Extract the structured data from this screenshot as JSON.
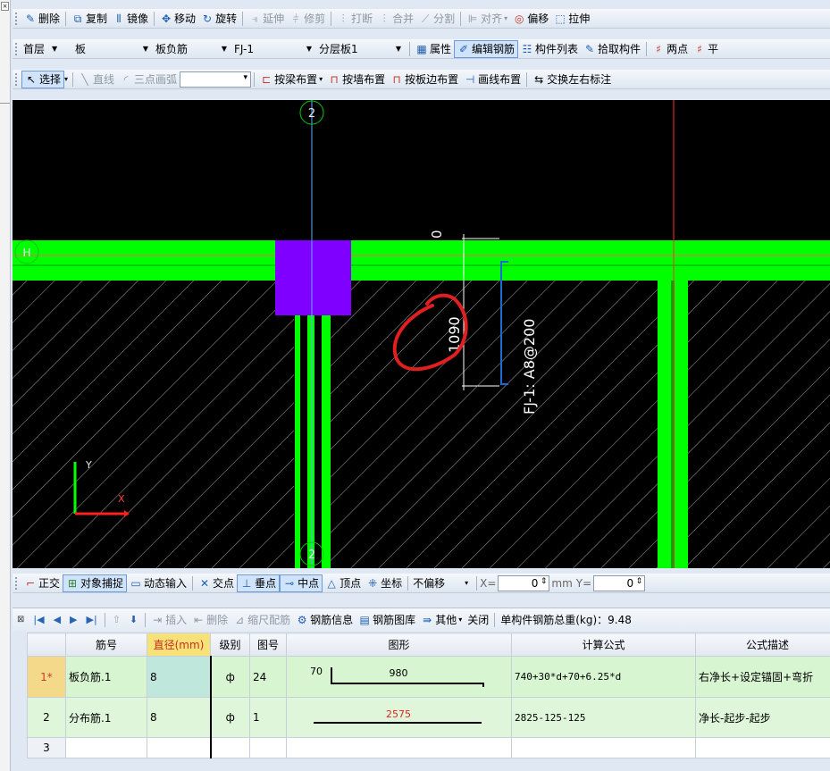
{
  "toolbar1": {
    "delete": "删除",
    "copy": "复制",
    "mirror": "镜像",
    "move": "移动",
    "rotate": "旋转",
    "extend": "延伸",
    "trim": "修剪",
    "break": "打断",
    "merge": "合并",
    "split": "分割",
    "align": "对齐",
    "offset": "偏移",
    "stretch": "拉伸"
  },
  "toolbar2": {
    "floor": "首层",
    "category": "板",
    "type": "板负筋",
    "name": "FJ-1",
    "layer": "分层板1",
    "properties": "属性",
    "edit_rebar": "编辑钢筋",
    "component_list": "构件列表",
    "pick_component": "拾取构件",
    "two_points": "两点",
    "parallel": "平"
  },
  "toolbar3": {
    "select": "选择",
    "line": "直线",
    "arc3": "三点画弧",
    "by_beam": "按梁布置",
    "by_wall": "按墙布置",
    "by_slab_edge": "按板边布置",
    "by_line": "画线布置",
    "swap_labels": "交换左右标注"
  },
  "canvas": {
    "axis_top": "2",
    "axis_bottom": "2",
    "axis_left": "H",
    "dim_zero": "0",
    "dim_length": "1090",
    "rebar_label": "FJ-1: A8@200",
    "y_axis": "Y",
    "x_axis": "X"
  },
  "snapbar": {
    "ortho": "正交",
    "object_snap": "对象捕捉",
    "dynamic_input": "动态输入",
    "intersection": "交点",
    "perpendicular": "垂点",
    "midpoint": "中点",
    "vertex": "顶点",
    "coordinate": "坐标",
    "offset_mode": "不偏移",
    "x_label": "X=",
    "x_value": "0",
    "unit": "mm",
    "y_label": "Y=",
    "y_value": "0"
  },
  "grid_toolbar": {
    "insert": "插入",
    "delete": "删除",
    "scale_rebar": "缩尺配筋",
    "rebar_info": "钢筋信息",
    "rebar_library": "钢筋图库",
    "other": "其他",
    "close": "关闭",
    "total_weight": "单构件钢筋总重(kg)：9.48"
  },
  "table": {
    "headers": [
      "筋号",
      "直径(mm)",
      "级别",
      "图号",
      "图形",
      "计算公式",
      "公式描述"
    ],
    "rows": [
      {
        "no": "1*",
        "name": "板负筋.1",
        "diameter": "8",
        "grade": "ф",
        "fig": "24",
        "shape_left": "70",
        "shape_len": "980",
        "formula": "740+30*d+70+6.25*d",
        "desc": "右净长+设定锚固+弯折"
      },
      {
        "no": "2",
        "name": "分布筋.1",
        "diameter": "8",
        "grade": "ф",
        "fig": "1",
        "shape_left": "",
        "shape_len": "2575",
        "formula": "2825-125-125",
        "desc": "净长-起步-起步"
      },
      {
        "no": "3",
        "name": "",
        "diameter": "",
        "grade": "",
        "fig": "",
        "shape_left": "",
        "shape_len": "",
        "formula": "",
        "desc": ""
      }
    ]
  },
  "colors": {
    "beam": "#00ff00",
    "column": "#8000ff",
    "rebar": "#1a6bd6",
    "annotation": "#e02020"
  }
}
